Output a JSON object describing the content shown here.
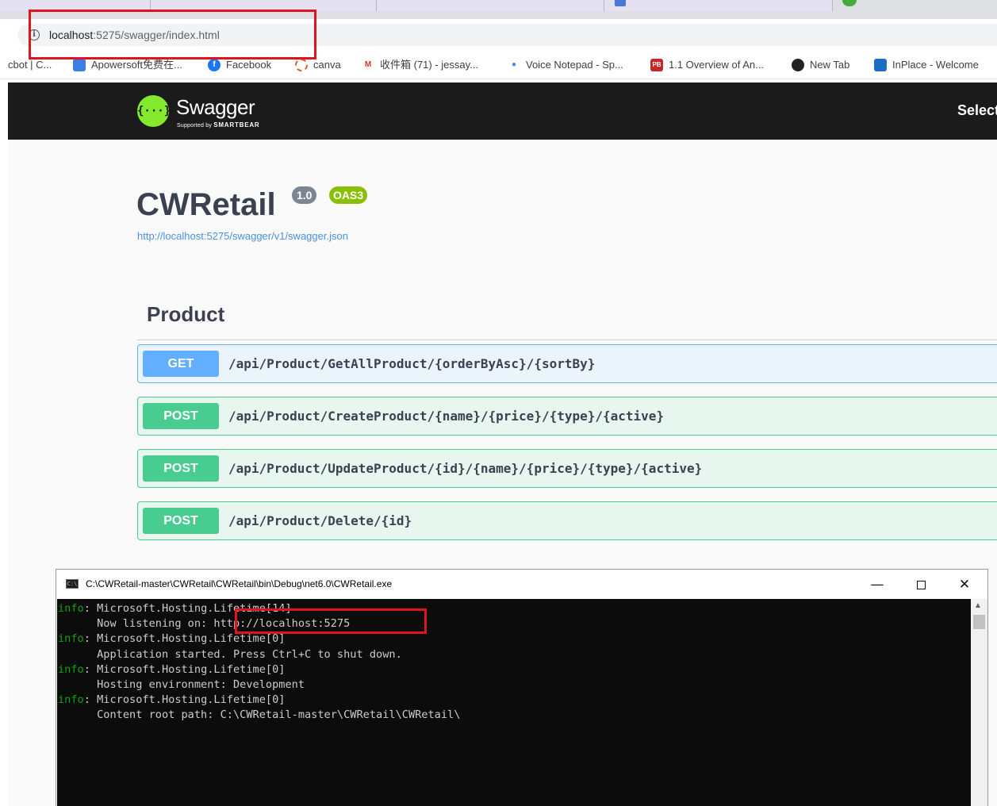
{
  "browser": {
    "address_host": "localhost",
    "address_rest": ":5275/swagger/index.html",
    "bookmarks": [
      {
        "label": "cbot | C...",
        "icon": ""
      },
      {
        "label": "Apowersoft免费在...",
        "icon": "apowersoft-icon"
      },
      {
        "label": "Facebook",
        "icon": "facebook-icon"
      },
      {
        "label": "canva",
        "icon": "canva-icon"
      },
      {
        "label": "收件箱 (71) - jessay...",
        "icon": "gmail-icon"
      },
      {
        "label": "Voice Notepad - Sp...",
        "icon": "microphone-icon"
      },
      {
        "label": "1.1 Overview of An...",
        "icon": "pb-icon",
        "icon_text": "PB"
      },
      {
        "label": "New Tab",
        "icon": "chrome-icon"
      },
      {
        "label": "InPlace - Welcome",
        "icon": "inplace-icon"
      }
    ]
  },
  "swagger": {
    "logo_text": "Swagger",
    "logo_glyph": "{···}",
    "logo_sub_small": "Supported by",
    "logo_sub_brand": "SMARTBEAR",
    "select_label": "Select",
    "title": "CWRetail",
    "version": "1.0",
    "oas": "OAS3",
    "spec_link": "http://localhost:5275/swagger/v1/swagger.json",
    "tag": "Product",
    "operations": [
      {
        "method": "GET",
        "path": "/api/Product/GetAllProduct/{orderByAsc}/{sortBy}"
      },
      {
        "method": "POST",
        "path": "/api/Product/CreateProduct/{name}/{price}/{type}/{active}"
      },
      {
        "method": "POST",
        "path": "/api/Product/UpdateProduct/{id}/{name}/{price}/{type}/{active}"
      },
      {
        "method": "POST",
        "path": "/api/Product/Delete/{id}"
      }
    ]
  },
  "console": {
    "icon_text": "C:\\",
    "title": "C:\\CWRetail-master\\CWRetail\\CWRetail\\bin\\Debug\\net6.0\\CWRetail.exe",
    "btn_min": "—",
    "btn_close": "✕",
    "lines": [
      {
        "prefix": "info",
        "text": ": Microsoft.Hosting.Lifetime[14]"
      },
      {
        "prefix": "",
        "text": "      Now listening on: http://localhost:5275"
      },
      {
        "prefix": "info",
        "text": ": Microsoft.Hosting.Lifetime[0]"
      },
      {
        "prefix": "",
        "text": "      Application started. Press Ctrl+C to shut down."
      },
      {
        "prefix": "info",
        "text": ": Microsoft.Hosting.Lifetime[0]"
      },
      {
        "prefix": "",
        "text": "      Hosting environment: Development"
      },
      {
        "prefix": "info",
        "text": ": Microsoft.Hosting.Lifetime[0]"
      },
      {
        "prefix": "",
        "text": "      Content root path: C:\\CWRetail-master\\CWRetail\\CWRetail\\"
      }
    ]
  },
  "colors": {
    "highlight": "#e0141e",
    "get": "#61affe",
    "post": "#49cc90",
    "console_info": "#13a10e"
  }
}
